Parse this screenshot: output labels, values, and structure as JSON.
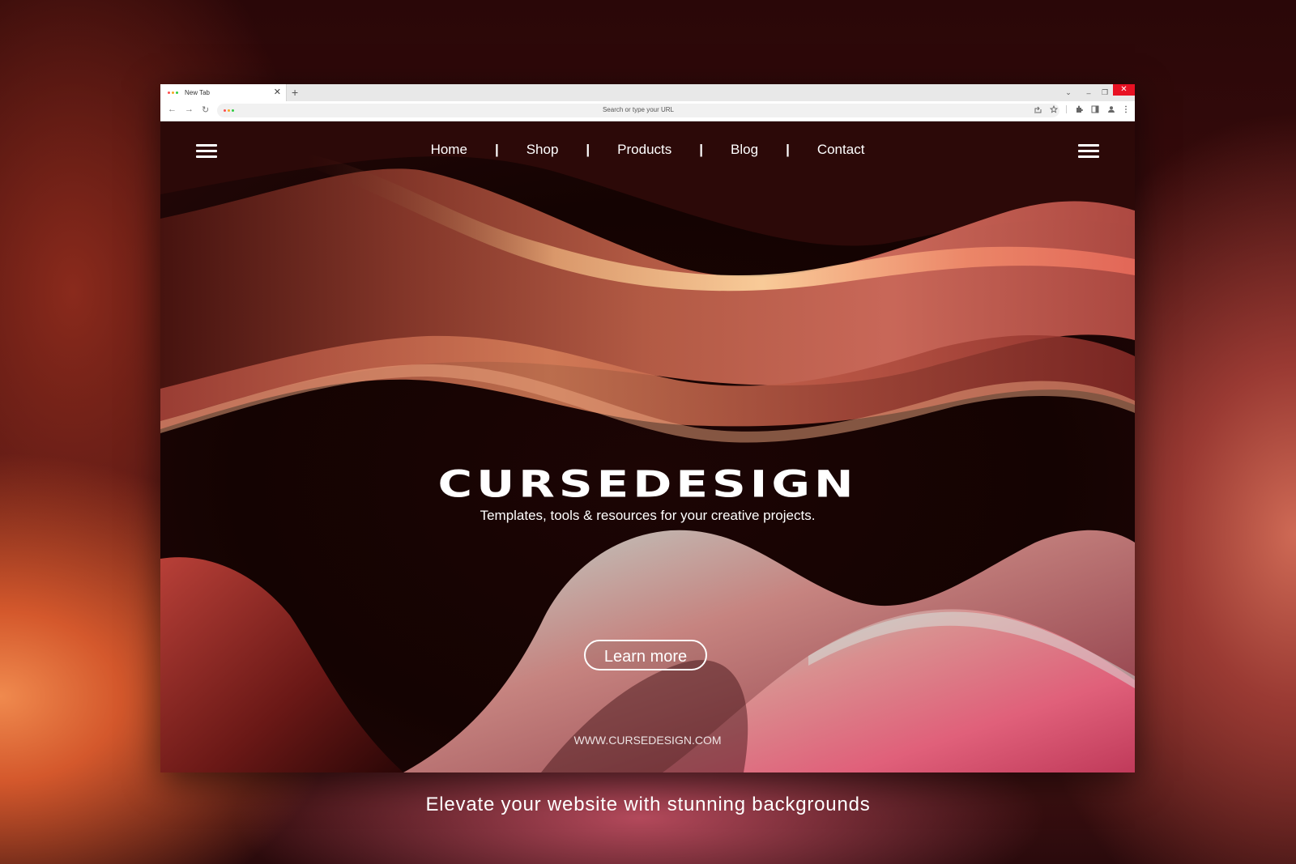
{
  "browser": {
    "tab_title": "New Tab",
    "tab_close": "✕",
    "new_tab": "+",
    "address_placeholder": "Search or type your URL",
    "nav_back": "←",
    "nav_forward": "→",
    "nav_reload": "↻",
    "window_controls": {
      "chevron": "⌄",
      "minimize": "–",
      "restore": "❐",
      "close": "✕"
    },
    "favicon_colors": [
      "#ff4d4d",
      "#f5a623",
      "#2ecc40"
    ]
  },
  "site": {
    "nav": [
      "Home",
      "Shop",
      "Products",
      "Blog",
      "Contact"
    ],
    "nav_separator": "|",
    "brand": "CURSEDESIGN",
    "tagline": "Templates, tools & resources for your creative projects.",
    "cta_label": "Learn more",
    "url": "WWW.CURSEDESIGN.COM"
  },
  "caption": "Elevate your website with stunning backgrounds"
}
